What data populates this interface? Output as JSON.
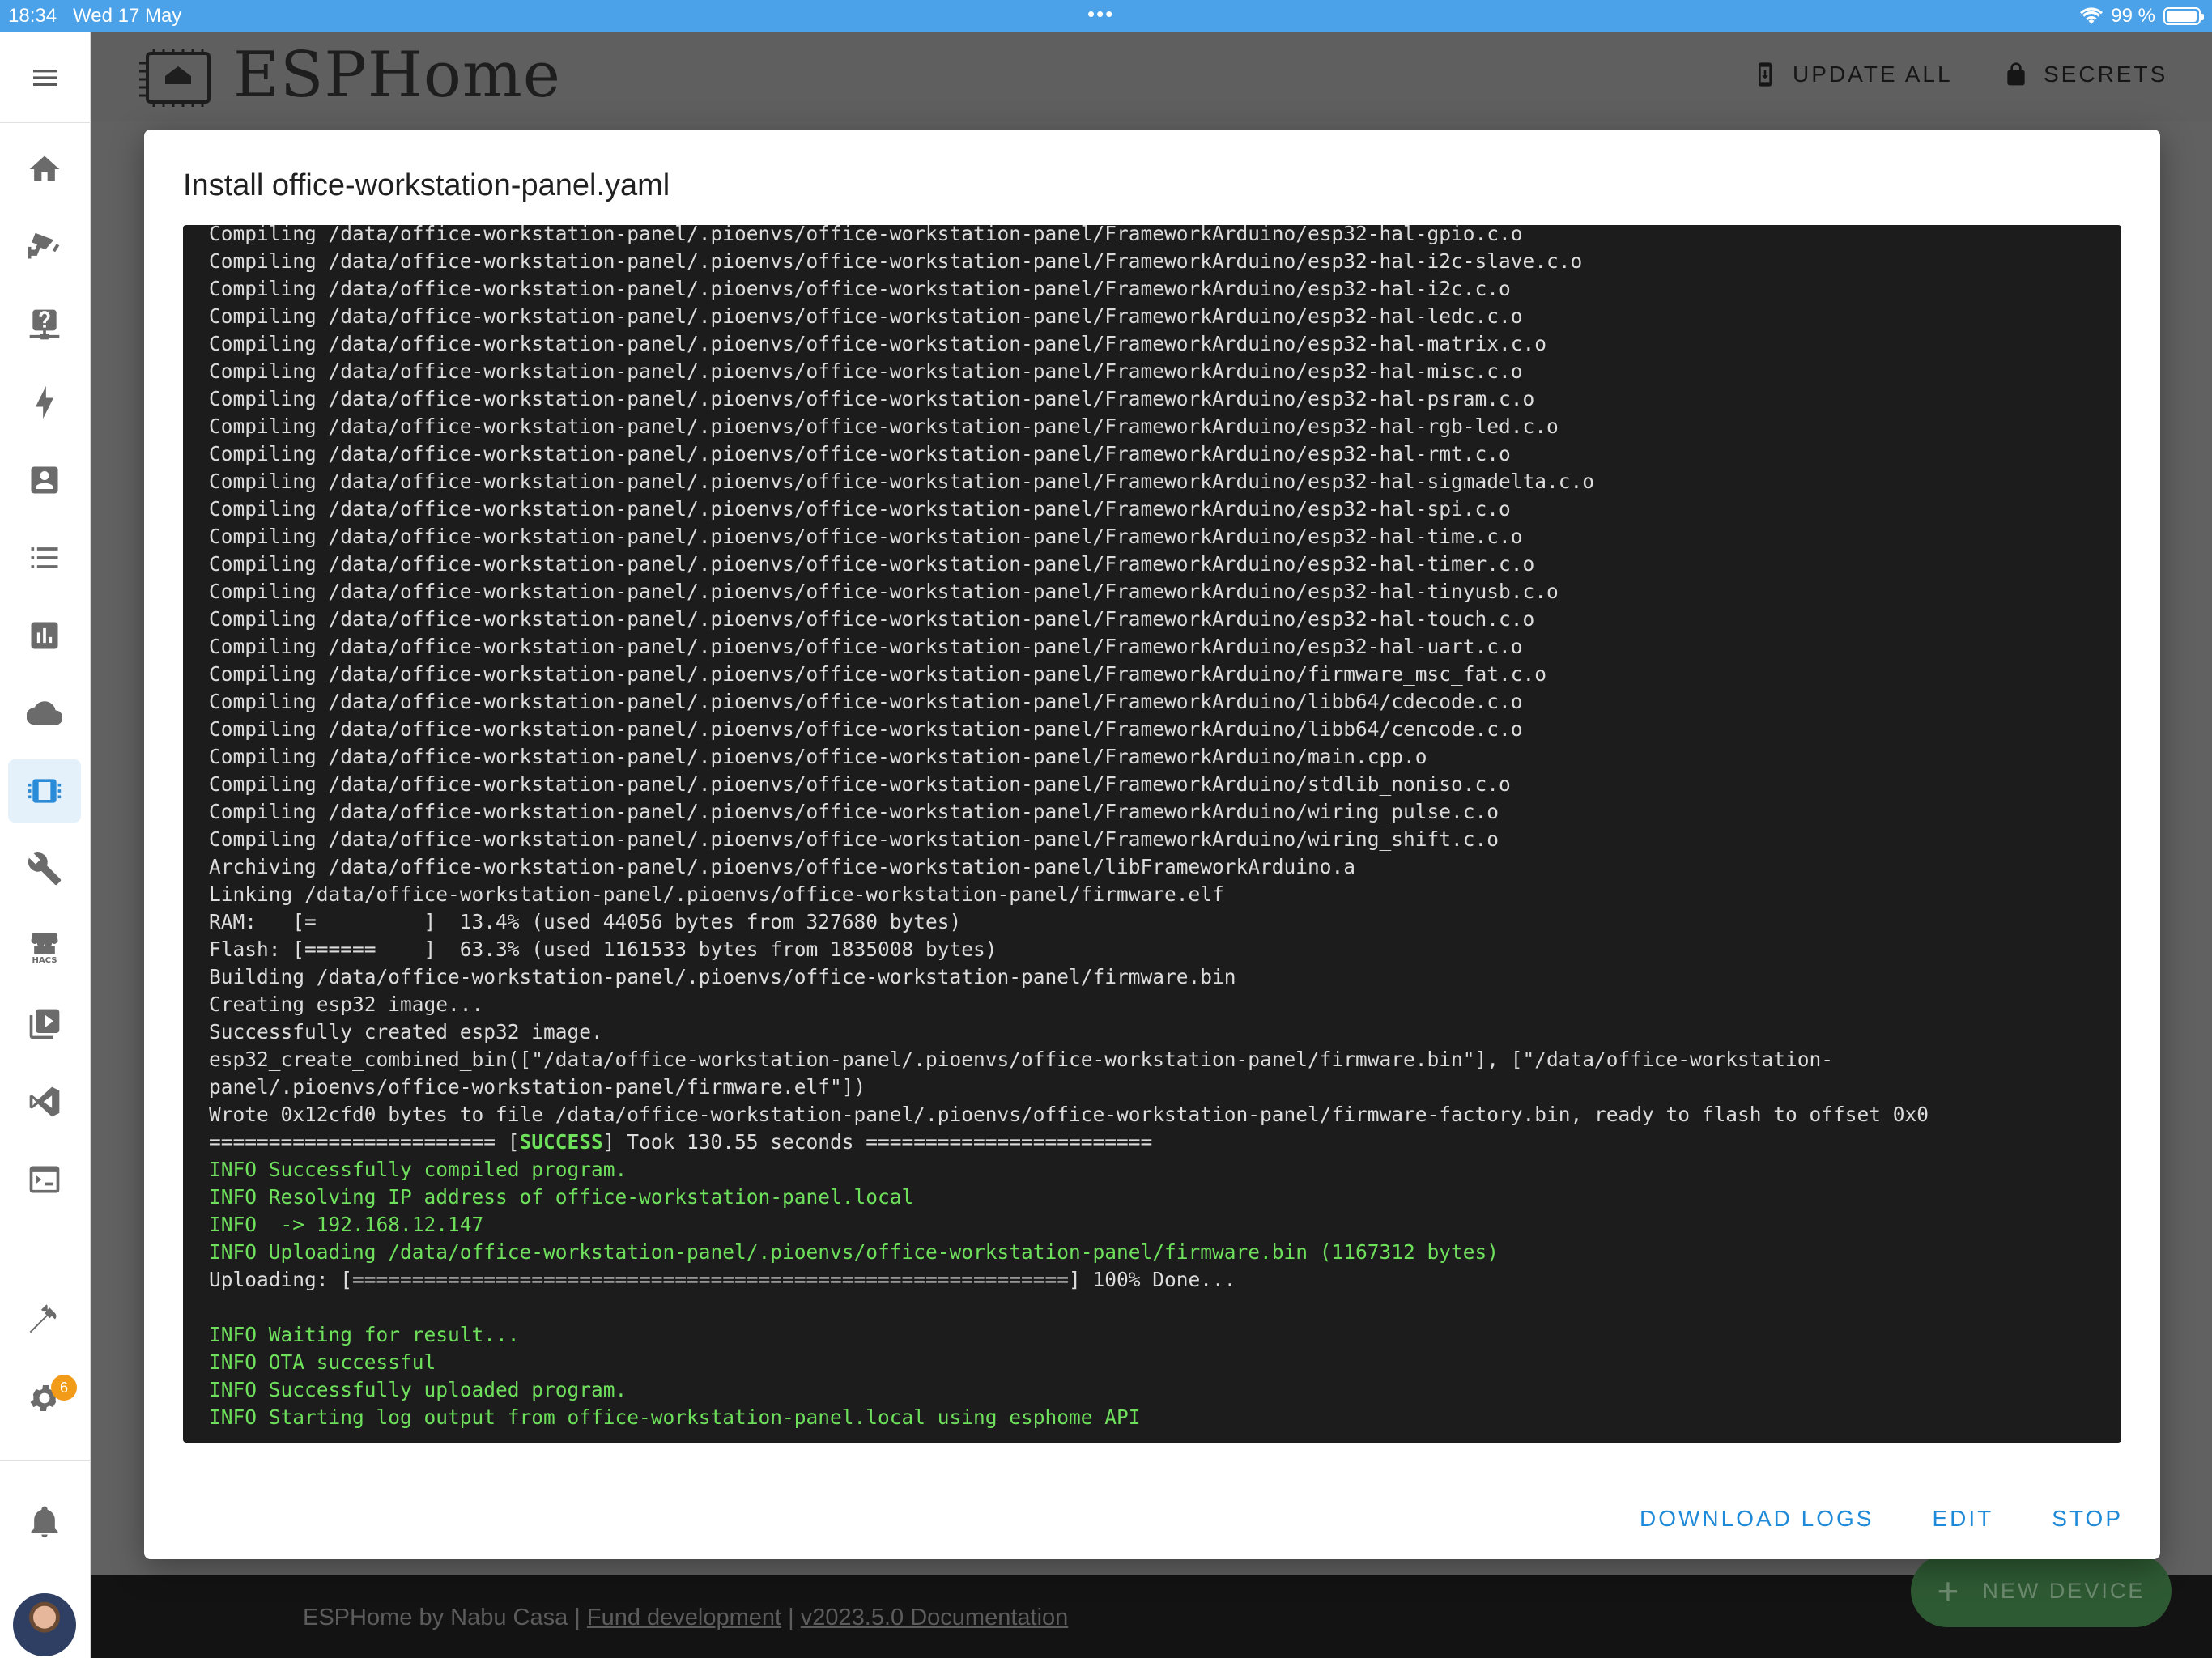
{
  "status_bar": {
    "time": "18:34",
    "date": "Wed 17 May",
    "battery": "99 %"
  },
  "sidebar": {
    "menu_icon": "menu-icon",
    "items": [
      {
        "name": "home",
        "icon": "home-icon"
      },
      {
        "name": "cctv",
        "icon": "cctv-icon"
      },
      {
        "name": "help-network",
        "icon": "help-network-icon"
      },
      {
        "name": "energy",
        "icon": "lightning-icon"
      },
      {
        "name": "account-box",
        "icon": "account-box-icon"
      },
      {
        "name": "logbook",
        "icon": "list-icon"
      },
      {
        "name": "history",
        "icon": "chart-box-icon"
      },
      {
        "name": "cloud",
        "icon": "cloud-icon"
      },
      {
        "name": "esphome",
        "icon": "chip-icon",
        "active": true
      },
      {
        "name": "tools",
        "icon": "wrench-icon"
      },
      {
        "name": "hacs",
        "icon": "hacs-icon",
        "label": "HACS"
      },
      {
        "name": "media",
        "icon": "play-box-icon"
      },
      {
        "name": "vscode",
        "icon": "vscode-icon"
      },
      {
        "name": "terminal",
        "icon": "console-icon"
      },
      {
        "name": "developer-tools",
        "icon": "hammer-icon"
      },
      {
        "name": "settings",
        "icon": "gear-icon",
        "badge": "6"
      },
      {
        "name": "notifications",
        "icon": "bell-icon"
      },
      {
        "name": "profile",
        "icon": "avatar"
      }
    ]
  },
  "header": {
    "title": "ESPHome",
    "update_all": "UPDATE ALL",
    "secrets": "SECRETS"
  },
  "dialog": {
    "title": "Install office-workstation-panel.yaml",
    "actions": {
      "download_logs": "DOWNLOAD LOGS",
      "edit": "EDIT",
      "stop": "STOP"
    },
    "log_lines": [
      {
        "text": "Compiling /data/office-workstation-panel/.pioenvs/office-workstation-panel/FrameworkArduino/esp32-hal-gpio.c.o",
        "style": "plain"
      },
      {
        "text": "Compiling /data/office-workstation-panel/.pioenvs/office-workstation-panel/FrameworkArduino/esp32-hal-i2c-slave.c.o",
        "style": "plain"
      },
      {
        "text": "Compiling /data/office-workstation-panel/.pioenvs/office-workstation-panel/FrameworkArduino/esp32-hal-i2c.c.o",
        "style": "plain"
      },
      {
        "text": "Compiling /data/office-workstation-panel/.pioenvs/office-workstation-panel/FrameworkArduino/esp32-hal-ledc.c.o",
        "style": "plain"
      },
      {
        "text": "Compiling /data/office-workstation-panel/.pioenvs/office-workstation-panel/FrameworkArduino/esp32-hal-matrix.c.o",
        "style": "plain"
      },
      {
        "text": "Compiling /data/office-workstation-panel/.pioenvs/office-workstation-panel/FrameworkArduino/esp32-hal-misc.c.o",
        "style": "plain"
      },
      {
        "text": "Compiling /data/office-workstation-panel/.pioenvs/office-workstation-panel/FrameworkArduino/esp32-hal-psram.c.o",
        "style": "plain"
      },
      {
        "text": "Compiling /data/office-workstation-panel/.pioenvs/office-workstation-panel/FrameworkArduino/esp32-hal-rgb-led.c.o",
        "style": "plain"
      },
      {
        "text": "Compiling /data/office-workstation-panel/.pioenvs/office-workstation-panel/FrameworkArduino/esp32-hal-rmt.c.o",
        "style": "plain"
      },
      {
        "text": "Compiling /data/office-workstation-panel/.pioenvs/office-workstation-panel/FrameworkArduino/esp32-hal-sigmadelta.c.o",
        "style": "plain"
      },
      {
        "text": "Compiling /data/office-workstation-panel/.pioenvs/office-workstation-panel/FrameworkArduino/esp32-hal-spi.c.o",
        "style": "plain"
      },
      {
        "text": "Compiling /data/office-workstation-panel/.pioenvs/office-workstation-panel/FrameworkArduino/esp32-hal-time.c.o",
        "style": "plain"
      },
      {
        "text": "Compiling /data/office-workstation-panel/.pioenvs/office-workstation-panel/FrameworkArduino/esp32-hal-timer.c.o",
        "style": "plain"
      },
      {
        "text": "Compiling /data/office-workstation-panel/.pioenvs/office-workstation-panel/FrameworkArduino/esp32-hal-tinyusb.c.o",
        "style": "plain"
      },
      {
        "text": "Compiling /data/office-workstation-panel/.pioenvs/office-workstation-panel/FrameworkArduino/esp32-hal-touch.c.o",
        "style": "plain"
      },
      {
        "text": "Compiling /data/office-workstation-panel/.pioenvs/office-workstation-panel/FrameworkArduino/esp32-hal-uart.c.o",
        "style": "plain"
      },
      {
        "text": "Compiling /data/office-workstation-panel/.pioenvs/office-workstation-panel/FrameworkArduino/firmware_msc_fat.c.o",
        "style": "plain"
      },
      {
        "text": "Compiling /data/office-workstation-panel/.pioenvs/office-workstation-panel/FrameworkArduino/libb64/cdecode.c.o",
        "style": "plain"
      },
      {
        "text": "Compiling /data/office-workstation-panel/.pioenvs/office-workstation-panel/FrameworkArduino/libb64/cencode.c.o",
        "style": "plain"
      },
      {
        "text": "Compiling /data/office-workstation-panel/.pioenvs/office-workstation-panel/FrameworkArduino/main.cpp.o",
        "style": "plain"
      },
      {
        "text": "Compiling /data/office-workstation-panel/.pioenvs/office-workstation-panel/FrameworkArduino/stdlib_noniso.c.o",
        "style": "plain"
      },
      {
        "text": "Compiling /data/office-workstation-panel/.pioenvs/office-workstation-panel/FrameworkArduino/wiring_pulse.c.o",
        "style": "plain"
      },
      {
        "text": "Compiling /data/office-workstation-panel/.pioenvs/office-workstation-panel/FrameworkArduino/wiring_shift.c.o",
        "style": "plain"
      },
      {
        "text": "Archiving /data/office-workstation-panel/.pioenvs/office-workstation-panel/libFrameworkArduino.a",
        "style": "plain"
      },
      {
        "text": "Linking /data/office-workstation-panel/.pioenvs/office-workstation-panel/firmware.elf",
        "style": "plain"
      },
      {
        "text": "RAM:   [=         ]  13.4% (used 44056 bytes from 327680 bytes)",
        "style": "plain"
      },
      {
        "text": "Flash: [======    ]  63.3% (used 1161533 bytes from 1835008 bytes)",
        "style": "plain"
      },
      {
        "text": "Building /data/office-workstation-panel/.pioenvs/office-workstation-panel/firmware.bin",
        "style": "plain"
      },
      {
        "text": "Creating esp32 image...",
        "style": "plain"
      },
      {
        "text": "Successfully created esp32 image.",
        "style": "plain"
      },
      {
        "text": "esp32_create_combined_bin([\"/data/office-workstation-panel/.pioenvs/office-workstation-panel/firmware.bin\"], [\"/data/office-workstation-",
        "style": "plain"
      },
      {
        "text": "panel/.pioenvs/office-workstation-panel/firmware.elf\"])",
        "style": "plain"
      },
      {
        "text": "Wrote 0x12cfd0 bytes to file /data/office-workstation-panel/.pioenvs/office-workstation-panel/firmware-factory.bin, ready to flash to offset 0x0",
        "style": "plain"
      },
      {
        "text": "======================== [",
        "style": "success",
        "tag": "SUCCESS",
        "after": "] Took 130.55 seconds ========================"
      },
      {
        "text": "INFO Successfully compiled program.",
        "style": "green"
      },
      {
        "text": "INFO Resolving IP address of office-workstation-panel.local",
        "style": "green"
      },
      {
        "text": "INFO  -> 192.168.12.147",
        "style": "green"
      },
      {
        "text": "INFO Uploading /data/office-workstation-panel/.pioenvs/office-workstation-panel/firmware.bin (1167312 bytes)",
        "style": "green"
      },
      {
        "text": "Uploading: [============================================================] 100% Done...",
        "style": "plain"
      },
      {
        "text": " ",
        "style": "plain"
      },
      {
        "text": "INFO Waiting for result...",
        "style": "green"
      },
      {
        "text": "INFO OTA successful",
        "style": "green"
      },
      {
        "text": "INFO Successfully uploaded program.",
        "style": "green"
      },
      {
        "text": "INFO Starting log output from office-workstation-panel.local using esphome API",
        "style": "green"
      }
    ]
  },
  "footer": {
    "credit": "ESPHome by Nabu Casa",
    "sep1": "|",
    "fund": "Fund development",
    "sep2": "|",
    "docs": "v2023.5.0 Documentation"
  },
  "fab": {
    "label": "NEW DEVICE"
  },
  "colors": {
    "accent": "#1f8ad8",
    "status_bar": "#4ba2e8",
    "console_bg": "#1c1c1c",
    "console_green": "#6ee05c",
    "badge": "#f29b18"
  }
}
